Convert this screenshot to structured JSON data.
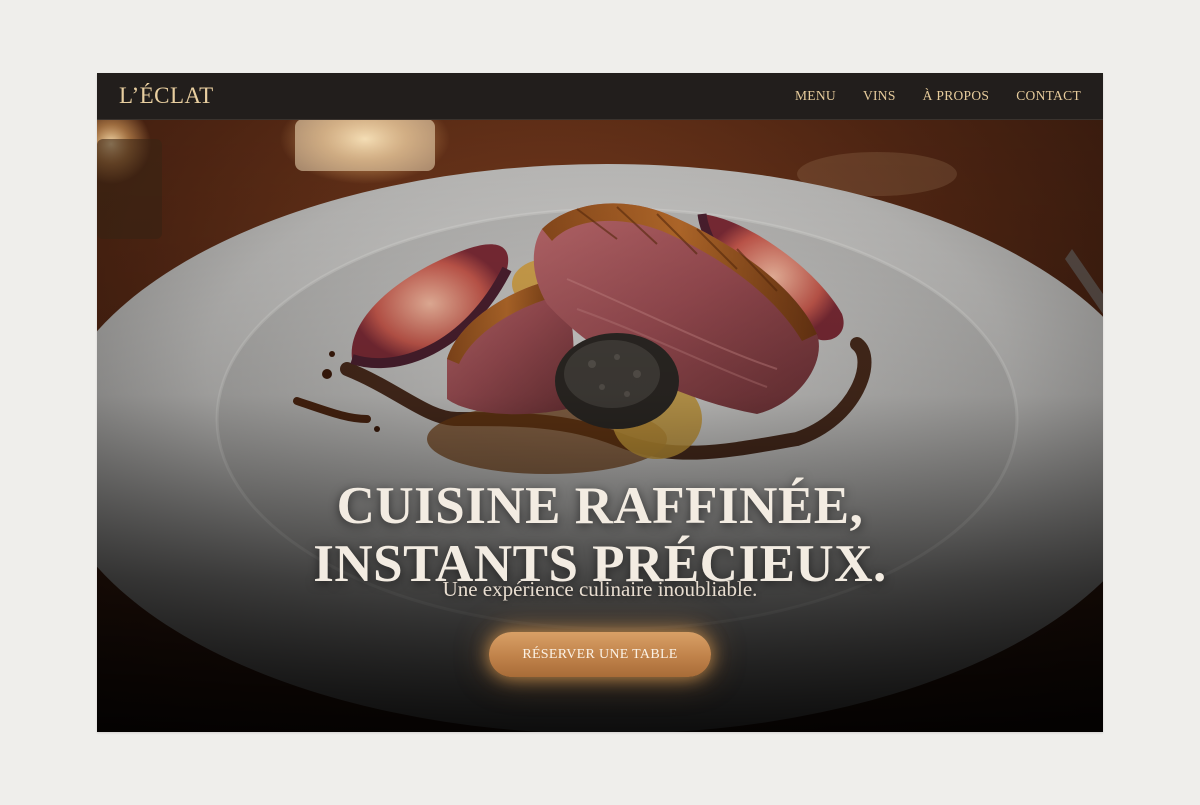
{
  "brand": {
    "logo_text": "L’ÉCLAT"
  },
  "nav": {
    "items": [
      {
        "label": "MENU"
      },
      {
        "label": "VINS"
      },
      {
        "label": "À PROPOS"
      },
      {
        "label": "CONTACT"
      }
    ]
  },
  "hero": {
    "headline_line1": "CUISINE RAFFINÉE,",
    "headline_line2": "INSTANTS PRÉCIEUX.",
    "subheadline": "Une expérience culinaire inoubliable.",
    "cta_label": "RÉSERVER UNE TABLE"
  },
  "colors": {
    "page_background": "#efeeeb",
    "nav_background": "#221e1c",
    "accent_gold": "#e7cc9c",
    "cta_copper": "#c0824a",
    "headline_text": "#f3ece2"
  }
}
